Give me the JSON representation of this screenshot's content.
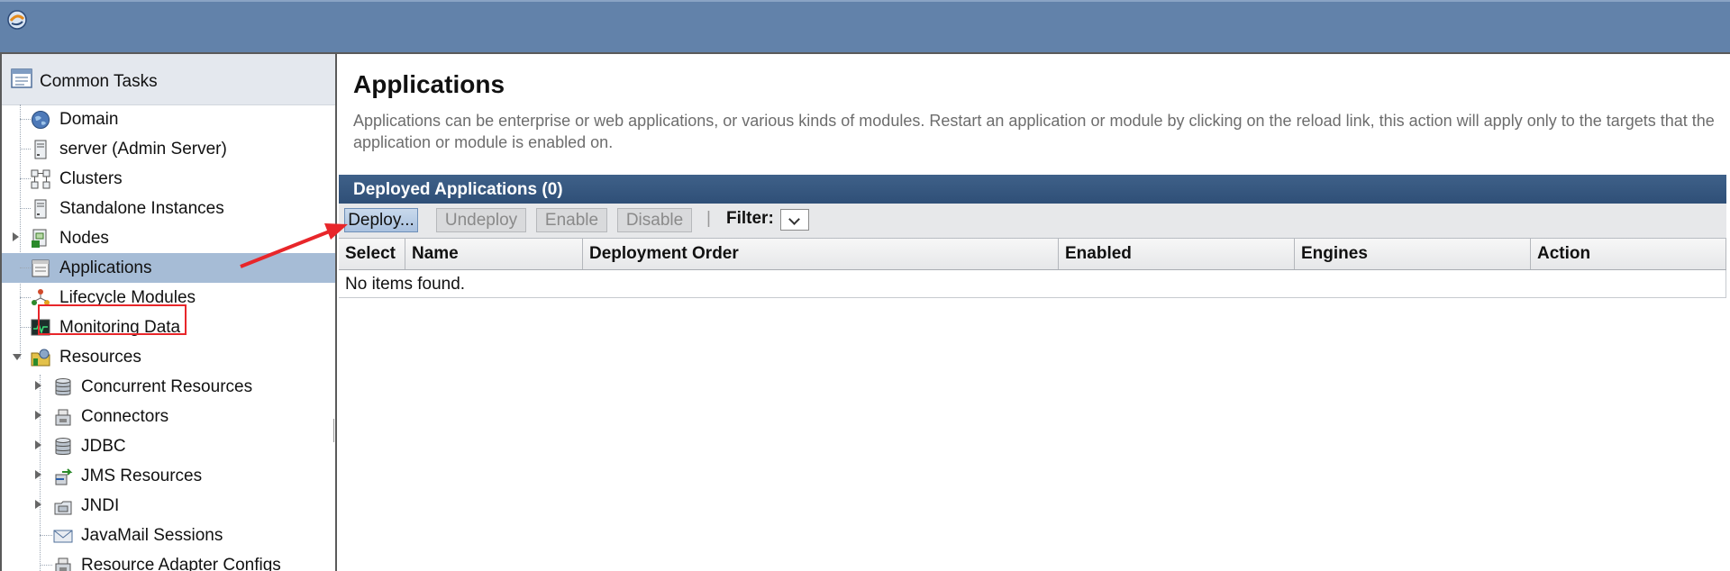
{
  "nav": {
    "header": "Common Tasks",
    "items": [
      {
        "label": "Domain",
        "icon": "globe-icon"
      },
      {
        "label": "server (Admin Server)",
        "icon": "server-icon"
      },
      {
        "label": "Clusters",
        "icon": "cluster-icon"
      },
      {
        "label": "Standalone Instances",
        "icon": "server-icon"
      },
      {
        "label": "Nodes",
        "icon": "node-icon"
      },
      {
        "label": "Applications",
        "icon": "applications-icon"
      },
      {
        "label": "Lifecycle Modules",
        "icon": "lifecycle-icon"
      },
      {
        "label": "Monitoring Data",
        "icon": "monitor-icon"
      },
      {
        "label": "Resources",
        "icon": "resources-icon"
      },
      {
        "label": "Concurrent Resources",
        "icon": "database-icon"
      },
      {
        "label": "Connectors",
        "icon": "connector-icon"
      },
      {
        "label": "JDBC",
        "icon": "database-icon"
      },
      {
        "label": "JMS Resources",
        "icon": "jms-icon"
      },
      {
        "label": "JNDI",
        "icon": "jndi-icon"
      },
      {
        "label": "JavaMail Sessions",
        "icon": "mail-icon"
      },
      {
        "label": "Resource Adapter Configs",
        "icon": "connector-icon"
      }
    ]
  },
  "main": {
    "title": "Applications",
    "description": "Applications can be enterprise or web applications, or various kinds of modules. Restart an application or module by clicking on the reload link, this action will apply only to the targets that the application or module is enabled on.",
    "table": {
      "title": "Deployed Applications (0)",
      "buttons": {
        "deploy": "Deploy...",
        "undeploy": "Undeploy",
        "enable": "Enable",
        "disable": "Disable"
      },
      "separator": "|",
      "filter_label": "Filter:",
      "columns": [
        "Select",
        "Name",
        "Deployment Order",
        "Enabled",
        "Engines",
        "Action"
      ],
      "empty_message": "No items found."
    }
  },
  "colors": {
    "banner": "#6282aa",
    "selected_row": "#a6bcd6",
    "annotation": "#e8262a",
    "table_title": "#3f6189"
  }
}
